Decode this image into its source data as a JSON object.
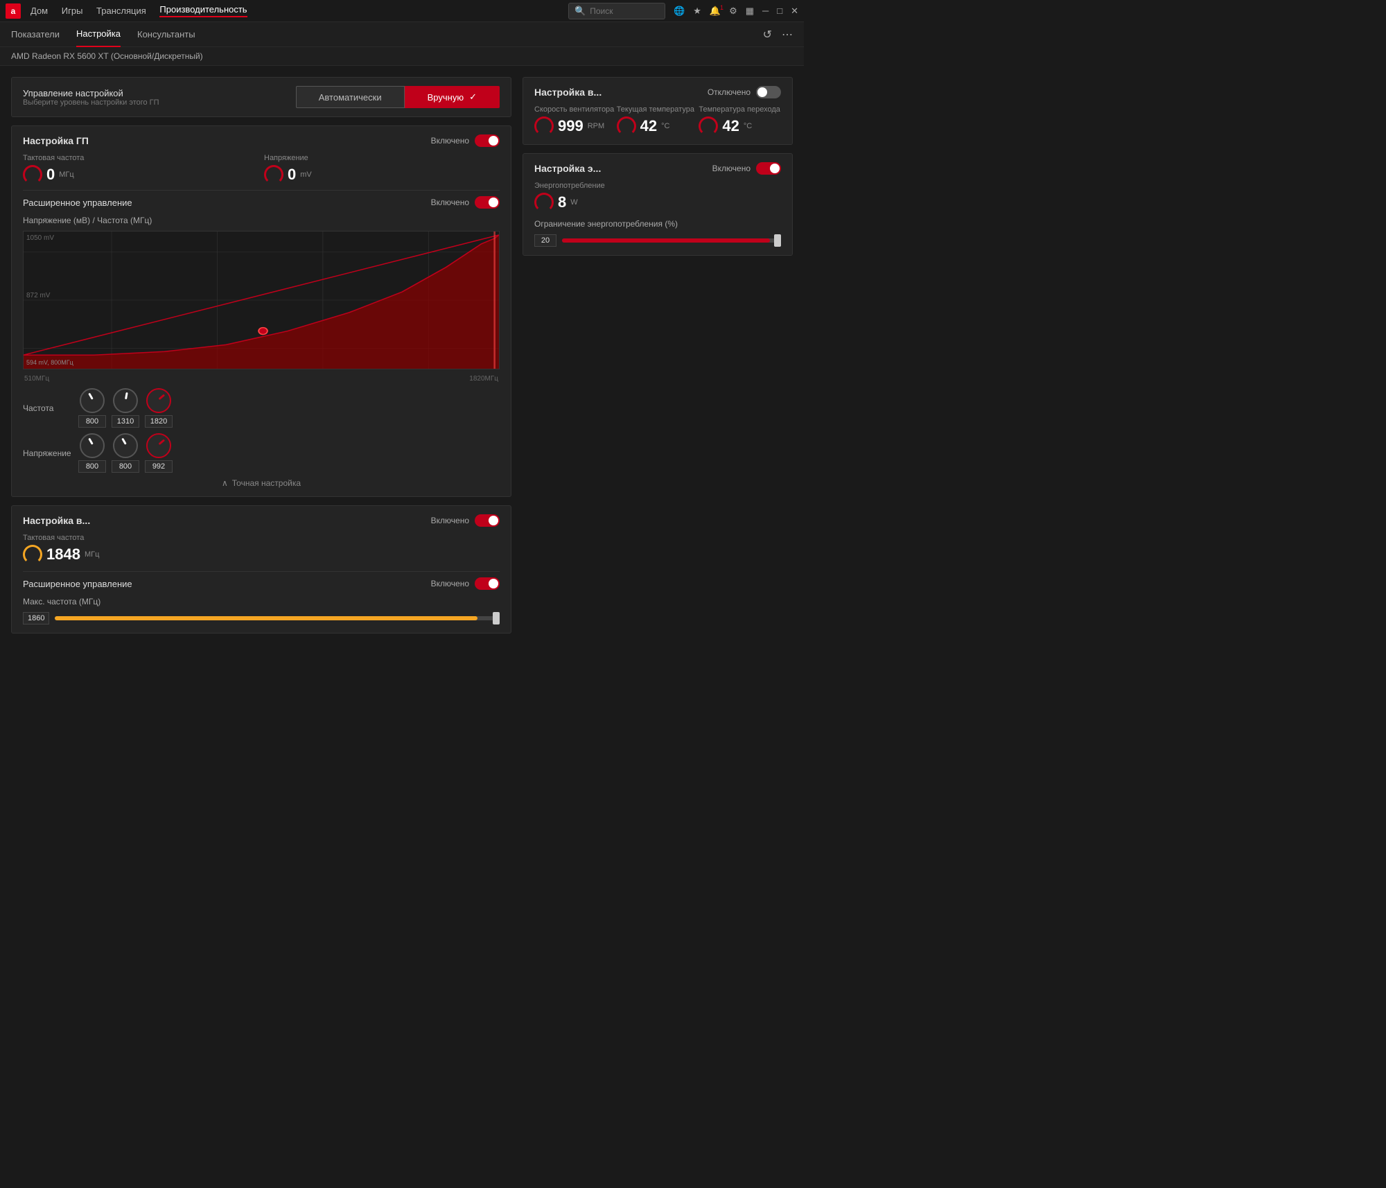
{
  "titlebar": {
    "logo": "a",
    "window_controls": [
      "?",
      "–",
      "□",
      "×"
    ]
  },
  "navbar": {
    "items": [
      "Дом",
      "Игры",
      "Трансляция",
      "Производительность"
    ],
    "active": "Производительность",
    "search_placeholder": "Поиск",
    "icons": [
      "globe",
      "star",
      "bell",
      "gear",
      "menu"
    ]
  },
  "subnav": {
    "items": [
      "Показатели",
      "Настройка",
      "Консультанты"
    ],
    "active": "Настройка",
    "icons": [
      "undo",
      "more"
    ]
  },
  "device": "AMD Radeon RX 5600 XT (Основной/Дискретный)",
  "control_mode": {
    "title": "Управление настройкой",
    "subtitle": "Выберите уровень настройки этого ГП",
    "btn_auto": "Автоматически",
    "btn_manual": "Вручную",
    "check": "✓"
  },
  "gpu_tuning": {
    "title": "Настройка ГП",
    "status": "Включено",
    "toggle": "on",
    "clock": {
      "label": "Тактовая частота",
      "value": "0",
      "unit": "МГц"
    },
    "voltage": {
      "label": "Напряжение",
      "value": "0",
      "unit": "mV"
    },
    "advanced": {
      "label": "Расширенное управление",
      "status": "Включено",
      "toggle": "on"
    },
    "chart": {
      "title": "Напряжение (мВ) / Частота (МГц)",
      "y_labels": [
        "1050 mV",
        "872 mV",
        "594 mV, 800МГц"
      ],
      "x_labels": [
        "510МГц",
        "1820МГц"
      ],
      "point_label": "594 mV, 800МГц"
    },
    "frequency_knobs": {
      "label": "Частота",
      "values": [
        "800",
        "1310",
        "1820"
      ]
    },
    "voltage_knobs": {
      "label": "Напряжение",
      "values": [
        "800",
        "800",
        "992"
      ]
    },
    "fine_tuning": "Точная настройка"
  },
  "vram_tuning": {
    "title": "Настройка в...",
    "status": "Включено",
    "toggle": "on",
    "clock": {
      "label": "Тактовая частота",
      "value": "1848",
      "unit": "МГц",
      "gauge_color": "yellow"
    },
    "advanced": {
      "label": "Расширенное управление",
      "status": "Включено",
      "toggle": "on"
    },
    "max_freq": {
      "label": "Макс. частота (МГц)",
      "value": "1860"
    }
  },
  "fan_tuning": {
    "title": "Настройка в...",
    "status": "Отключено",
    "toggle": "off",
    "fan_speed": {
      "label": "Скорость вентилятора",
      "value": "999",
      "unit": "RPM"
    },
    "current_temp": {
      "label": "Текущая температура",
      "value": "42",
      "unit": "°С"
    },
    "junction_temp": {
      "label": "Температура перехода",
      "value": "42",
      "unit": "°С"
    }
  },
  "power_tuning": {
    "title": "Настройка э...",
    "status": "Включено",
    "toggle": "on",
    "consumption": {
      "label": "Энергопотребление",
      "value": "8",
      "unit": "W"
    },
    "limit": {
      "label": "Ограничение энергопотребления (%)",
      "value": "20"
    }
  }
}
